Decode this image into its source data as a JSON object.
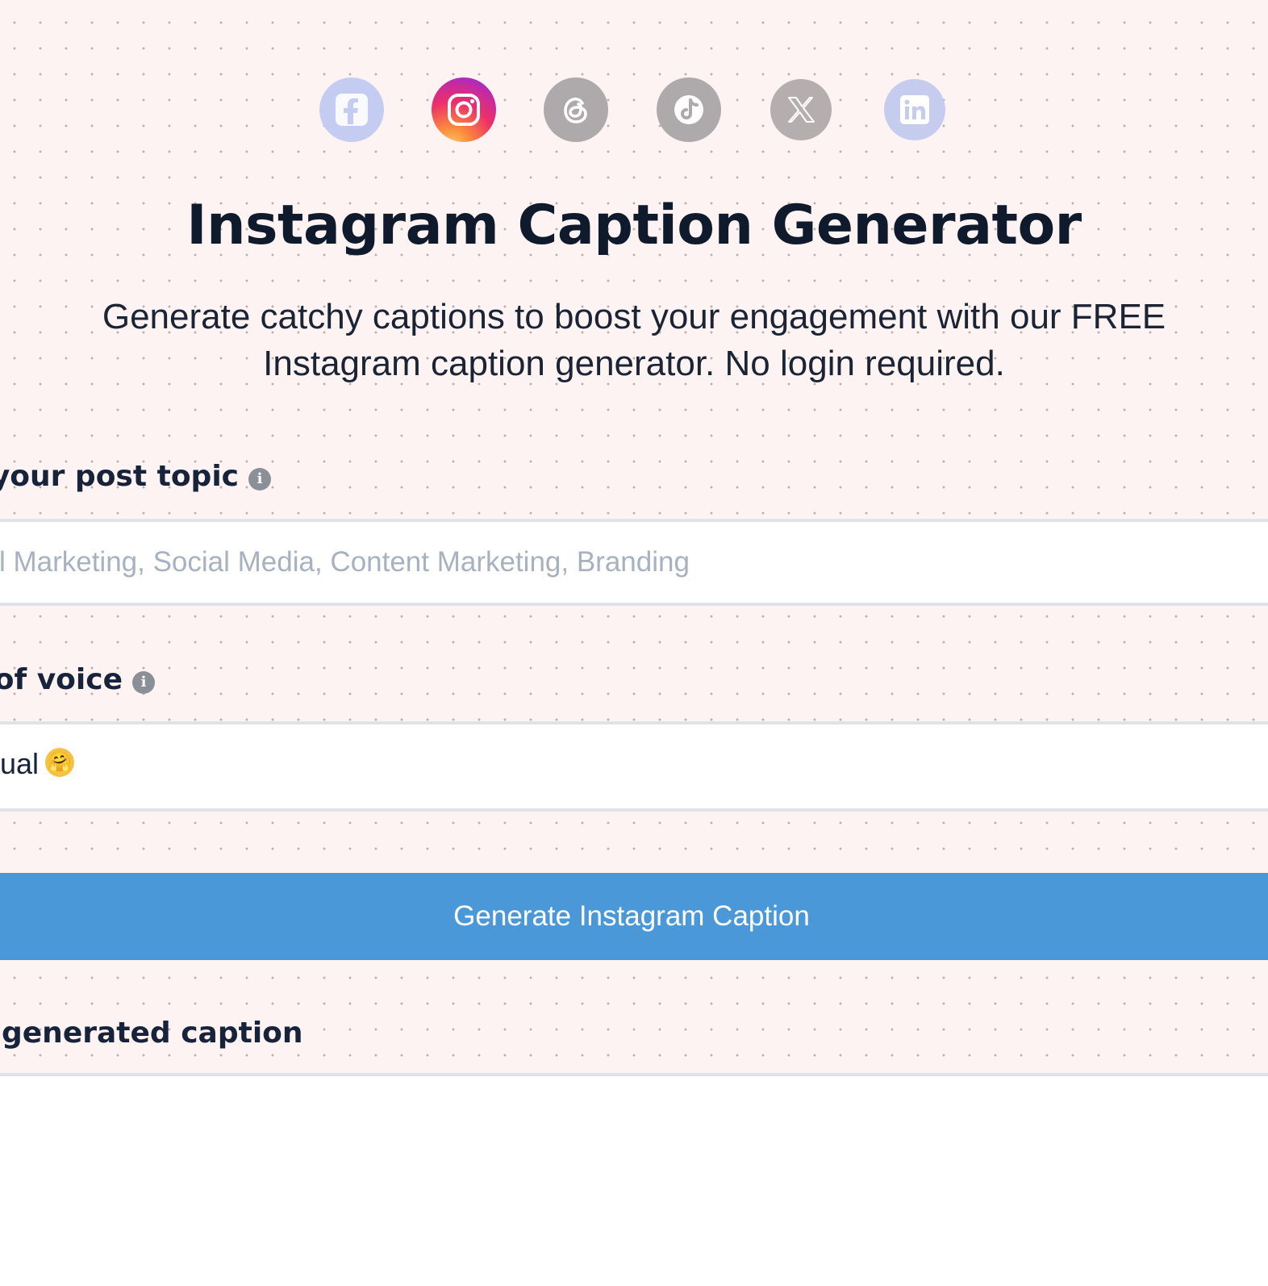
{
  "social_icons": [
    {
      "name": "facebook-icon",
      "active": false
    },
    {
      "name": "instagram-icon",
      "active": true
    },
    {
      "name": "threads-icon",
      "active": false
    },
    {
      "name": "tiktok-icon",
      "active": false
    },
    {
      "name": "x-icon",
      "active": false
    },
    {
      "name": "linkedin-icon",
      "active": false
    }
  ],
  "page": {
    "title": "Instagram Caption Generator",
    "subtitle_line1": "Generate catchy captions to boost your engagement with our FREE",
    "subtitle_line2": "Instagram caption generator. No login required."
  },
  "topic_field": {
    "label": "r your post topic",
    "placeholder": "ital Marketing, Social Media, Content Marketing, Branding",
    "value": ""
  },
  "voice_field": {
    "label": "of voice",
    "selected": "sual",
    "selected_emoji": "🤗"
  },
  "generate_button": {
    "label": "Generate Instagram Caption"
  },
  "output": {
    "label": "generated caption"
  },
  "colors": {
    "background": "#fcf3f2",
    "primary_button": "#4a98d8",
    "heading": "#0f1b2d",
    "placeholder": "#a7b1bf"
  }
}
